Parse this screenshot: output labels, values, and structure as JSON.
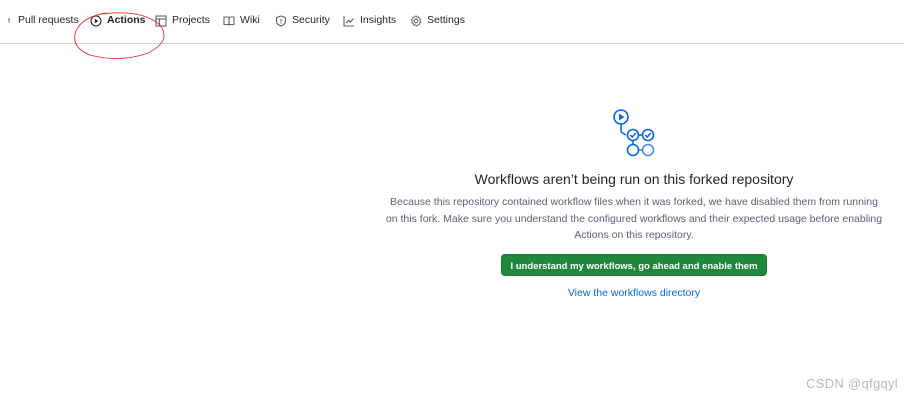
{
  "nav": {
    "items": [
      {
        "label": "Pull requests",
        "icon": "pull-request-icon"
      },
      {
        "label": "Actions",
        "icon": "play-icon",
        "active": true
      },
      {
        "label": "Projects",
        "icon": "table-icon"
      },
      {
        "label": "Wiki",
        "icon": "book-icon"
      },
      {
        "label": "Security",
        "icon": "shield-icon"
      },
      {
        "label": "Insights",
        "icon": "graph-icon"
      },
      {
        "label": "Settings",
        "icon": "gear-icon"
      }
    ]
  },
  "empty_state": {
    "icon": "workflow-icon",
    "title": "Workflows aren’t being run on this forked repository",
    "description": "Because this repository contained workflow files when it was forked, we have disabled them from running on this fork. Make sure you understand the configured workflows and their expected usage before enabling Actions on this repository.",
    "button_label": "I understand my workflows, go ahead and enable them",
    "link_label": "View the workflows directory"
  },
  "watermark": "CSDN @qfgqyl",
  "colors": {
    "accent": "#1f883d",
    "link": "#0969da",
    "icon_blue": "#0969da",
    "annotation": "#e0302f"
  }
}
